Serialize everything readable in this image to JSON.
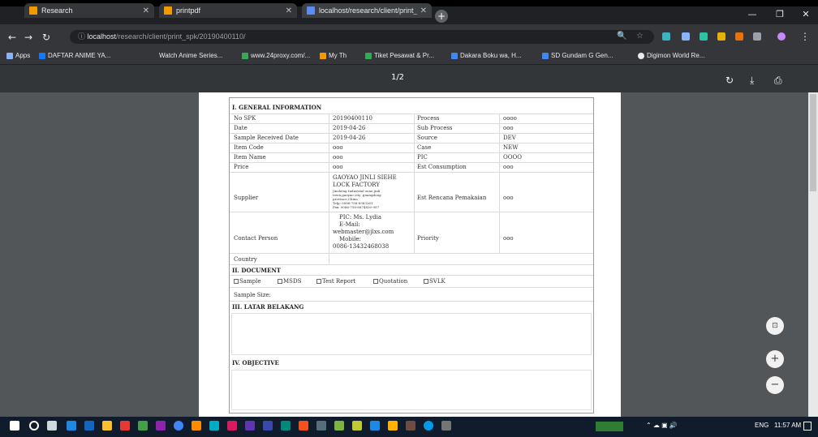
{
  "browser": {
    "tabs": [
      {
        "title": "Research",
        "active": false
      },
      {
        "title": "printpdf",
        "active": false
      },
      {
        "title": "localhost/research/client/print_s…",
        "active": true
      }
    ],
    "url_host": "localhost",
    "url_path": "/research/client/print_spk/20190400110/",
    "bookmarks": [
      "Apps",
      "DAFTAR ANIME YA...",
      "Watch Anime Series...",
      "www.24proxy.com/...",
      "My Th",
      "Tiket Pesawat & Pr...",
      "Dakara Boku wa, H...",
      "SD Gundam G Gen...",
      "Digimon World Re..."
    ]
  },
  "pdf": {
    "page_count": "1/2"
  },
  "document": {
    "general_title": "I. GENERAL INFORMATION",
    "left_rows": [
      {
        "label": "No SPK",
        "value": "20190400110"
      },
      {
        "label": "Date",
        "value": "2019-04-26"
      },
      {
        "label": "Sample Received Date",
        "value": "2019-04-26"
      },
      {
        "label": "Item Code",
        "value": "ooo"
      },
      {
        "label": "Item Name",
        "value": "ooo"
      },
      {
        "label": "Price",
        "value": "ooo"
      }
    ],
    "right_rows": [
      {
        "label": "Process",
        "value": "oooo"
      },
      {
        "label": "Sub Process",
        "value": "ooo"
      },
      {
        "label": "Source",
        "value": "DEV"
      },
      {
        "label": "Case",
        "value": "NEW"
      },
      {
        "label": "PIC",
        "value": "OOOO"
      },
      {
        "label": "Est Consumption",
        "value": "ooo"
      }
    ],
    "supplier_label": "Supplier",
    "supplier_name_1": "GAOYAO JINLI SIEHE",
    "supplier_name_2": "LOCK FACTORY",
    "supplier_addr_1": "Jinsheng Industrial zone,jinli",
    "supplier_addr_2": "town,gaoyao city ,guangdong",
    "supplier_addr_3": "province,China",
    "supplier_tel": "Telp: 0086-758-8383261",
    "supplier_fax": "Fax: 0086-758-8874830-957",
    "est_label": "Est Rencana Pemakaian",
    "est_value": "ooo",
    "contact_label": "Contact Person",
    "contact_pic": "PIC: Ms. Lydia",
    "contact_email_label": "E-Mail:",
    "contact_email": "webmaster@jlxs.com",
    "contact_mobile_label": "Mobile:",
    "contact_mobile": "0086-13432468038",
    "priority_label": "Priority",
    "priority_value": "ooo",
    "country_label": "Country",
    "document_title": "II. DOCUMENT",
    "checkboxes": [
      "Sample",
      "MSDS",
      "Test Report",
      "Quotation",
      "SVLK"
    ],
    "sample_size": "Sample Size:",
    "latar_title": "III. LATAR BELAKANG",
    "objective_title": "IV. OBJECTIVE"
  },
  "taskbar": {
    "lang": "ENG",
    "time": "11:57 AM"
  },
  "colors": {
    "accent": "#f29900",
    "chrome": "#35363a",
    "pdf_bg": "#525659"
  }
}
